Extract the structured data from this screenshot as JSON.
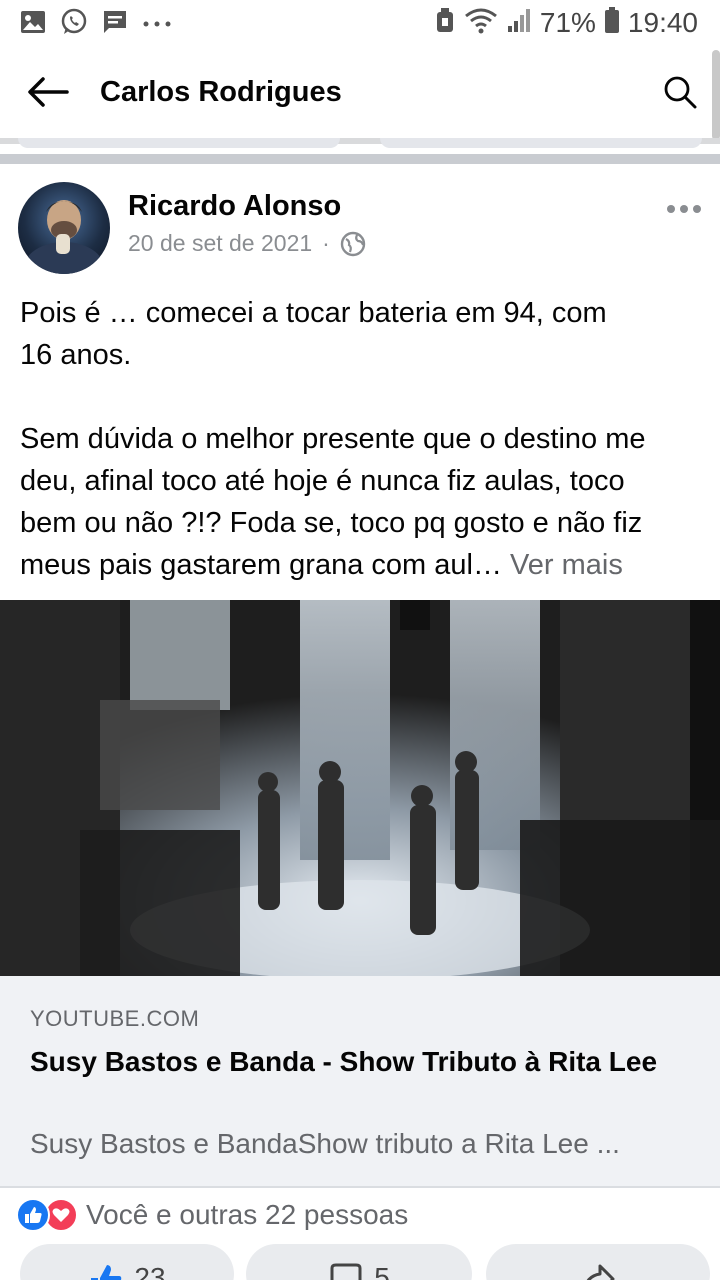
{
  "status_bar": {
    "battery": "71%",
    "time": "19:40",
    "icons": [
      "gallery-icon",
      "whatsapp-icon",
      "message-icon",
      "more-notifications-icon",
      "alarm-icon",
      "wifi-icon",
      "signal-icon",
      "battery-icon"
    ]
  },
  "header": {
    "title": "Carlos Rodrigues",
    "back_icon": "arrow-left-icon",
    "search_icon": "search-icon"
  },
  "post": {
    "author": "Ricardo Alonso",
    "date": "20 de set de 2021",
    "separator": "·",
    "privacy_icon": "globe-icon",
    "text_lines": [
      "Pois é … comecei a tocar bateria em 94, com",
      "16 anos.",
      "",
      "Sem dúvida o melhor presente que o destino me",
      "deu, afinal toco até hoje é nunca fiz aulas, toco",
      "bem ou não ?!? Foda se, toco pq gosto e não fiz"
    ],
    "last_line": "meus pais gastarem grana com aul…",
    "see_more": "Ver mais",
    "link": {
      "domain": "YOUTUBE.COM",
      "title": "Susy Bastos e Banda - Show Tributo à Rita Lee",
      "description": "Susy Bastos e BandaShow tributo a Rita Lee ..."
    },
    "reactions": {
      "types": [
        "like",
        "love"
      ],
      "text": "Você e outras 22 pessoas"
    },
    "actions": {
      "like_count": "23",
      "comment_count": "5"
    }
  },
  "colors": {
    "facebook_blue": "#1877f2",
    "love_red": "#f33e58",
    "secondary_text": "#65676b",
    "card_background": "#f0f2f5"
  }
}
